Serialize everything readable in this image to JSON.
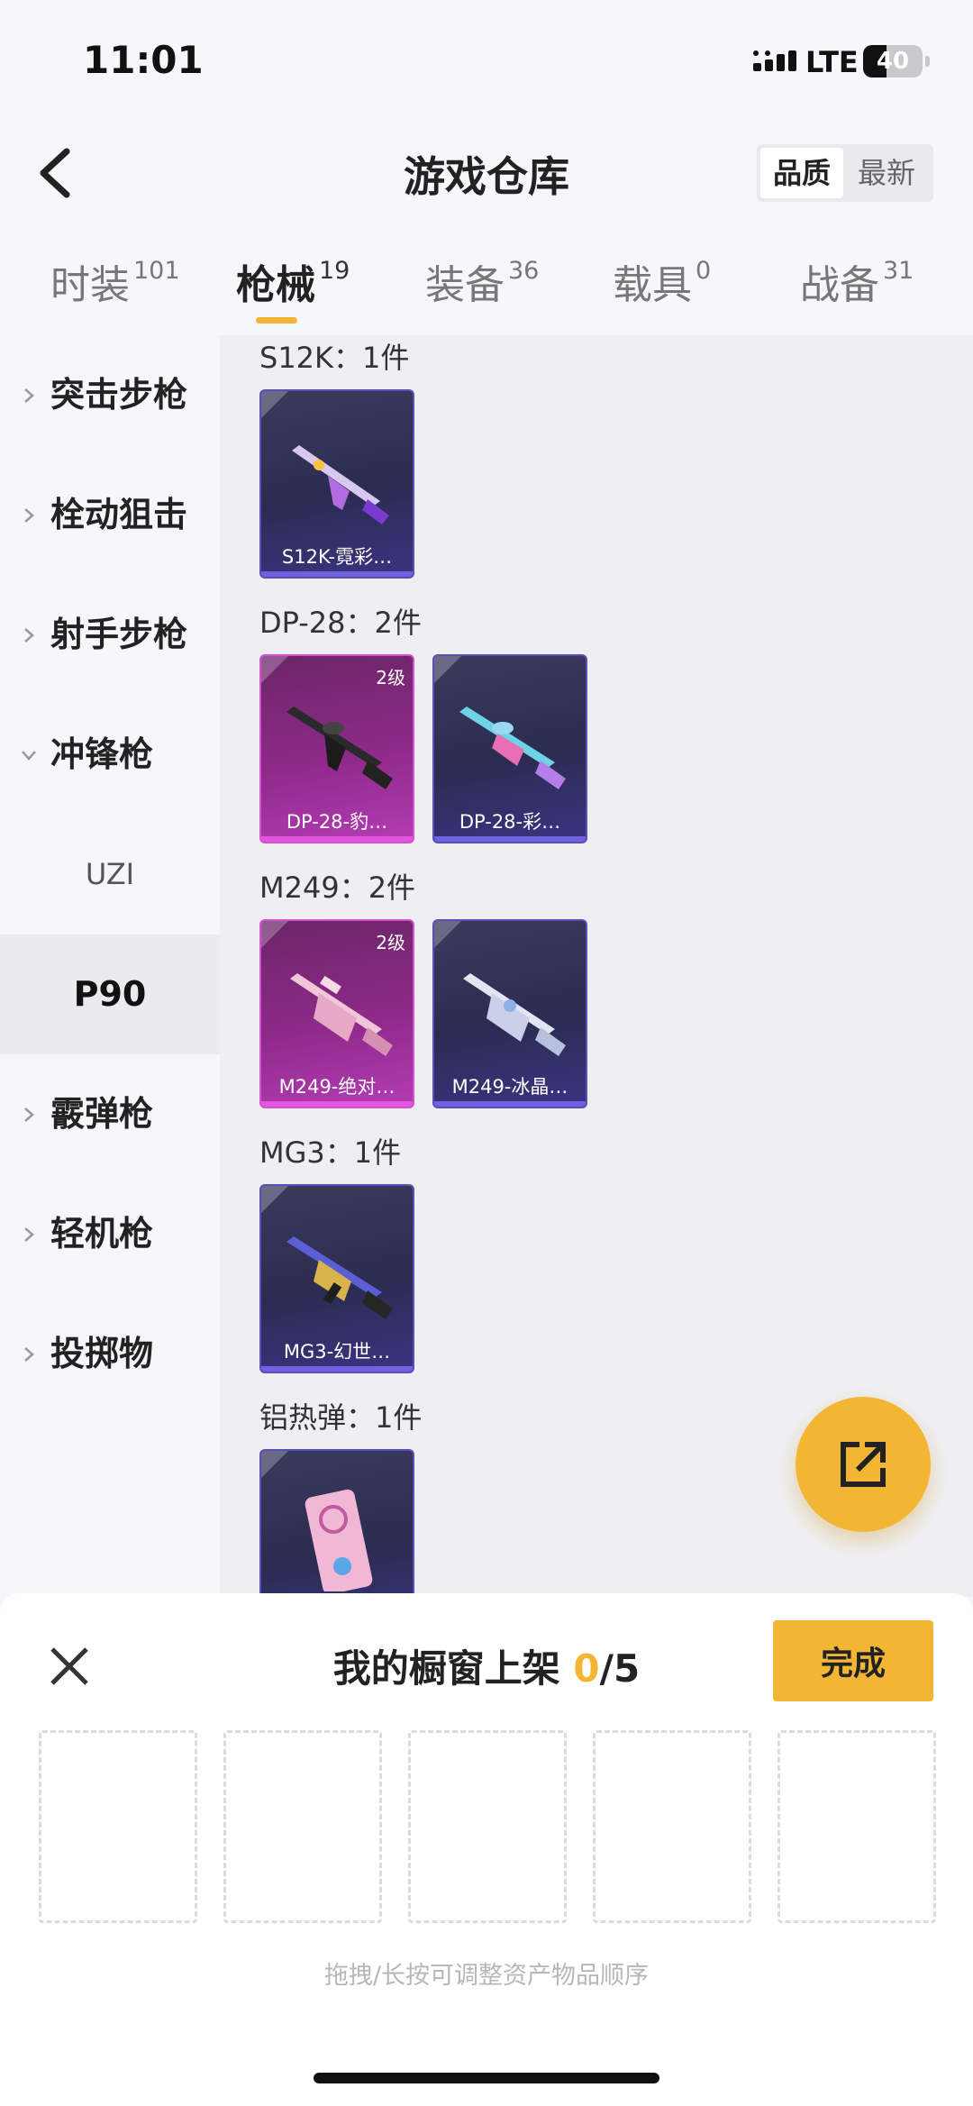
{
  "status_bar": {
    "time": "11:01",
    "network": "LTE",
    "battery": "40",
    "battery_level": 0.4
  },
  "header": {
    "title": "游戏仓库",
    "sort_options": [
      "品质",
      "最新"
    ],
    "sort_selected": "品质"
  },
  "tabs": [
    {
      "label": "时装",
      "count": "101"
    },
    {
      "label": "枪械",
      "count": "19"
    },
    {
      "label": "装备",
      "count": "36"
    },
    {
      "label": "载具",
      "count": "0"
    },
    {
      "label": "战备",
      "count": "31"
    }
  ],
  "active_tab": "枪械",
  "sidebar": {
    "items": [
      {
        "label": "突击步枪",
        "expanded": false
      },
      {
        "label": "栓动狙击",
        "expanded": false
      },
      {
        "label": "射手步枪",
        "expanded": false
      },
      {
        "label": "冲锋枪",
        "expanded": true
      },
      {
        "label": "UZI",
        "sub": true
      },
      {
        "label": "P90",
        "sub": true,
        "selected": true
      },
      {
        "label": "霰弹枪",
        "expanded": false
      },
      {
        "label": "轻机枪",
        "expanded": false
      },
      {
        "label": "投掷物",
        "expanded": false
      }
    ]
  },
  "groups": [
    {
      "title": "S12K：1件",
      "items": [
        {
          "name": "S12K-霓彩…",
          "rarity": "blue",
          "level": ""
        }
      ]
    },
    {
      "title": "DP-28：2件",
      "items": [
        {
          "name": "DP-28-豹…",
          "rarity": "pink",
          "level": "2级"
        },
        {
          "name": "DP-28-彩…",
          "rarity": "blue",
          "level": ""
        }
      ]
    },
    {
      "title": "M249：2件",
      "items": [
        {
          "name": "M249-绝对…",
          "rarity": "pink",
          "level": "2级"
        },
        {
          "name": "M249-冰晶…",
          "rarity": "blue",
          "level": ""
        }
      ]
    },
    {
      "title": "MG3：1件",
      "items": [
        {
          "name": "MG3-幻世…",
          "rarity": "blue",
          "level": ""
        }
      ]
    },
    {
      "title": "铝热弹：1件",
      "items": [
        {
          "name": "",
          "rarity": "blue",
          "level": ""
        }
      ]
    }
  ],
  "sheet": {
    "title": "我的橱窗上架",
    "count_current": "0",
    "count_total": "/5",
    "done_label": "完成",
    "slots": 5,
    "hint": "拖拽/长按可调整资产物品顺序"
  },
  "colors": {
    "accent": "#f2b634",
    "rarity_blue": "#5a4fb5",
    "rarity_pink": "#d253cf"
  },
  "icons": {
    "back": "chevron-left-icon",
    "share": "share-icon",
    "close": "close-icon"
  }
}
